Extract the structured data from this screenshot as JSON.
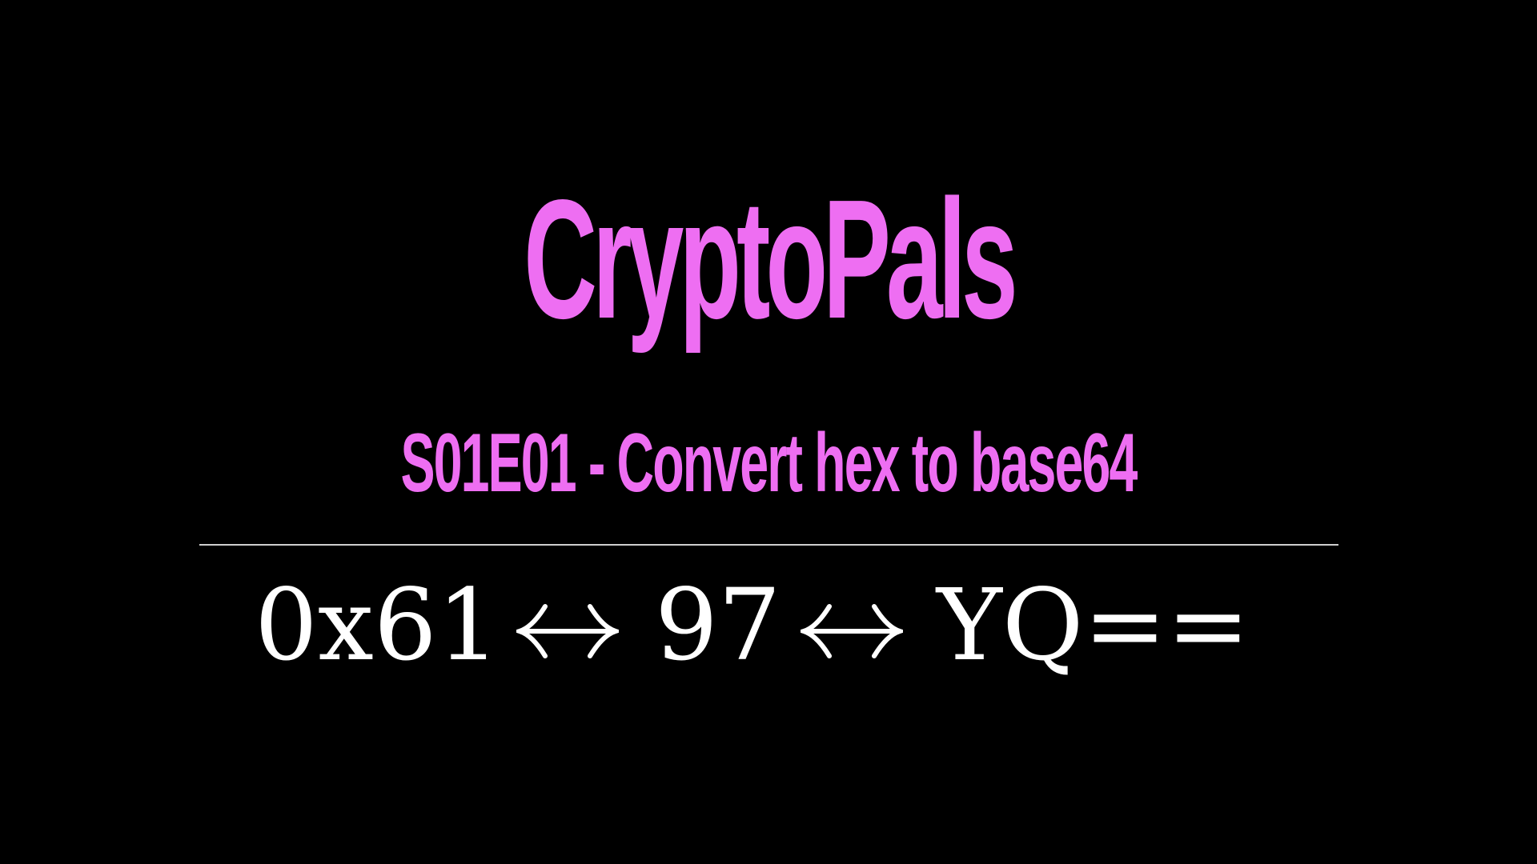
{
  "slide": {
    "title": "CryptoPals",
    "subtitle": "S01E01 - Convert hex to base64",
    "equation": {
      "hex": "0x61",
      "decimal": "97",
      "base64": "YQ=="
    }
  },
  "colors": {
    "background": "#000000",
    "accent": "#ee6ef2",
    "equation_text": "#ffffff",
    "divider": "#cfcfcf"
  },
  "icons": {
    "arrow": "left-right-arrow-icon"
  }
}
